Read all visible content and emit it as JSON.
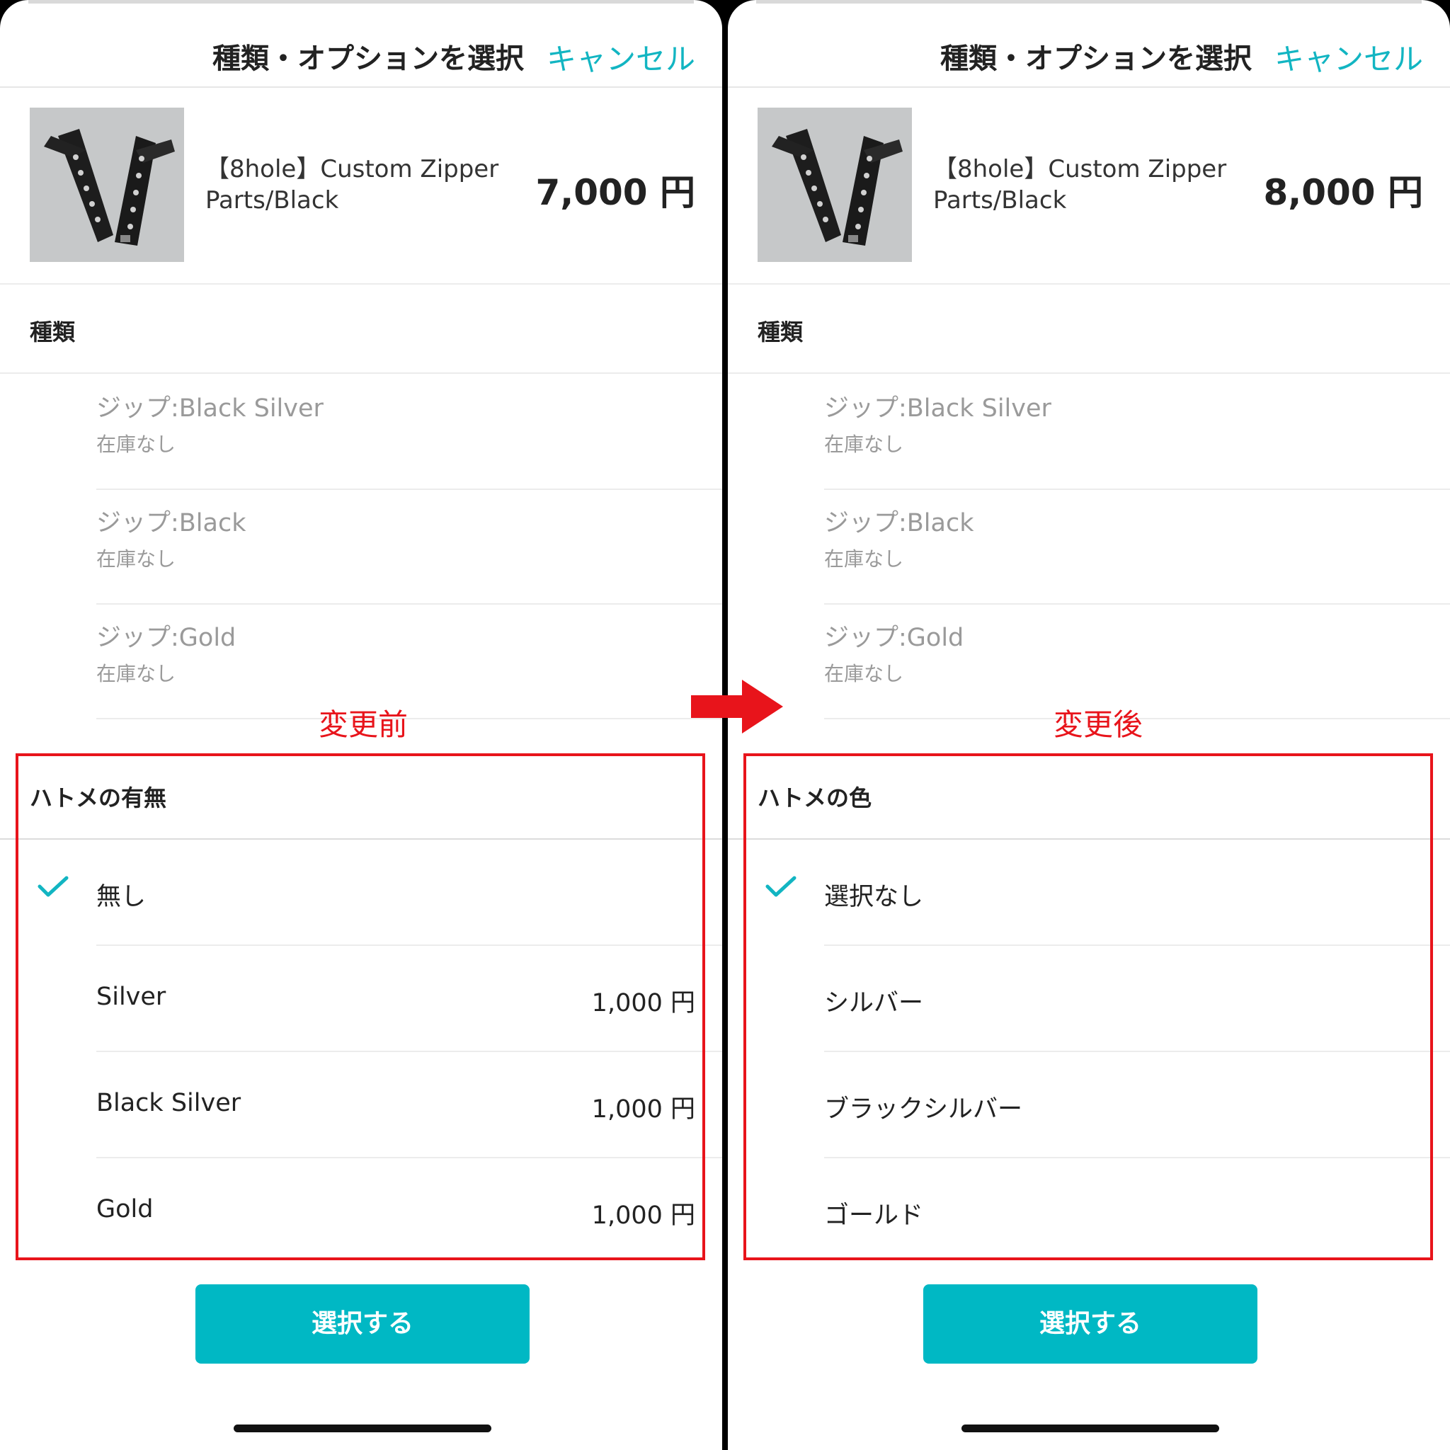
{
  "arrow_color": "#e8141b",
  "accent_color": "#12b5c2",
  "left": {
    "header": {
      "title": "種類・オプションを選択",
      "cancel": "キャンセル"
    },
    "product": {
      "name": "【8hole】Custom Zipper Parts/Black",
      "price": "7,000 円"
    },
    "variant_section": {
      "label": "種類"
    },
    "variants": [
      {
        "name": "ジップ:Black Silver",
        "stock": "在庫なし"
      },
      {
        "name": "ジップ:Black",
        "stock": "在庫なし"
      },
      {
        "name": "ジップ:Gold",
        "stock": "在庫なし"
      }
    ],
    "annotation": "変更前",
    "option_section": {
      "label": "ハトメの有無"
    },
    "options": [
      {
        "name": "無し",
        "price": "",
        "checked": true
      },
      {
        "name": "Silver",
        "price": "1,000 円"
      },
      {
        "name": "Black Silver",
        "price": "1,000 円"
      },
      {
        "name": "Gold",
        "price": "1,000 円"
      }
    ],
    "button": "選択する"
  },
  "right": {
    "header": {
      "title": "種類・オプションを選択",
      "cancel": "キャンセル"
    },
    "product": {
      "name": "【8hole】Custom Zipper Parts/Black",
      "price": "8,000 円"
    },
    "variant_section": {
      "label": "種類"
    },
    "variants": [
      {
        "name": "ジップ:Black Silver",
        "stock": "在庫なし"
      },
      {
        "name": "ジップ:Black",
        "stock": "在庫なし"
      },
      {
        "name": "ジップ:Gold",
        "stock": "在庫なし"
      }
    ],
    "annotation": "変更後",
    "option_section": {
      "label": "ハトメの色"
    },
    "options": [
      {
        "name": "選択なし",
        "price": "",
        "checked": true
      },
      {
        "name": "シルバー",
        "price": ""
      },
      {
        "name": "ブラックシルバー",
        "price": ""
      },
      {
        "name": "ゴールド",
        "price": ""
      }
    ],
    "button": "選択する"
  }
}
